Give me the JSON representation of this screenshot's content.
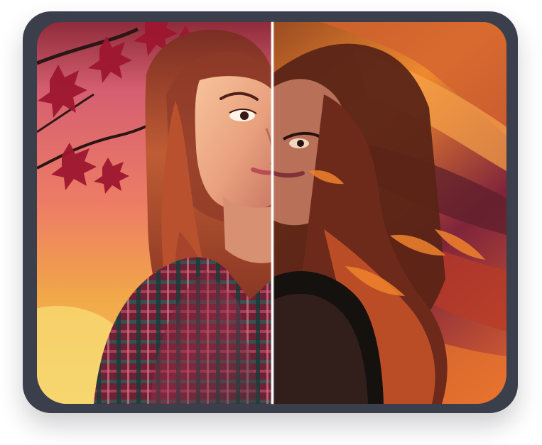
{
  "viewer": {
    "left_panel": {
      "image": "portrait-enhanced"
    },
    "right_panel": {
      "image": "portrait-stylized"
    }
  },
  "colors": {
    "frame": "#3b3f4c",
    "divider": "#ffffff",
    "sky_top": "#d86b79",
    "sky_bottom": "#f2b44a",
    "hair": "#9b4428",
    "shirt": "#6f2633"
  }
}
